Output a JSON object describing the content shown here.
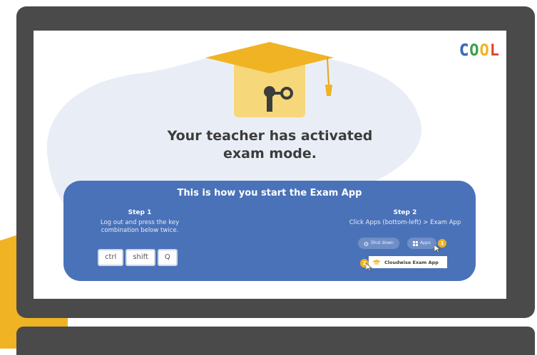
{
  "logo": {
    "letters": [
      "C",
      "O",
      "O",
      "L"
    ],
    "colors": [
      "#3b6bb5",
      "#3aa047",
      "#f0b323",
      "#e0452e"
    ]
  },
  "screen": {
    "title_line1": "Your teacher has activated",
    "title_line2": "exam mode."
  },
  "panel": {
    "title": "This is how you start the Exam App",
    "step1": {
      "heading": "Step 1",
      "text_line1": "Log out and press the key",
      "text_line2": "combination below twice."
    },
    "keys": [
      "ctrl",
      "shift",
      "Q"
    ],
    "step2": {
      "heading": "Step 2",
      "text": "Click Apps (bottom-left) > Exam App"
    },
    "shutdown_label": "Shut down",
    "apps_label": "Apps",
    "badge1": "1",
    "badge2": "2",
    "exam_app_label": "Cloudwise Exam App"
  },
  "colors": {
    "panel": "#4a72b8",
    "accent": "#f0b323",
    "laptop": "#4a4a4a"
  }
}
